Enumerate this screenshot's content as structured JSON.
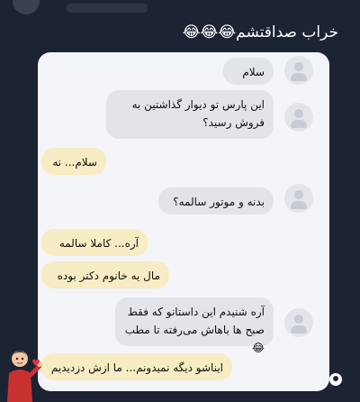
{
  "post": {
    "text": "خراب صداقتشم😂😂😂"
  },
  "chat": {
    "messages": [
      {
        "side": "in",
        "text": "سلام"
      },
      {
        "side": "in",
        "text": "این پارس تو دیوار گذاشتین به فروش رسید؟"
      },
      {
        "side": "out",
        "text": "سلام... نه"
      },
      {
        "side": "in",
        "text": "بدنه و موتور سالمه؟"
      },
      {
        "side": "out",
        "text": "آره... کاملا سالمه"
      },
      {
        "side": "out",
        "text": "مال یه خانوم دکتر بوده"
      },
      {
        "side": "in",
        "text": "آره شنیدم این داستانو که فقط صبح ها باهاش می‌رفته تا مطب😂"
      },
      {
        "side": "out",
        "text": "ایناشو دیگه نمیدونم... ما ازش دزدیدیم"
      }
    ]
  },
  "icons": {
    "avatar": "user-avatar-icon",
    "cartoon": "cartoon-character-icon",
    "account": "account-circle-icon"
  }
}
